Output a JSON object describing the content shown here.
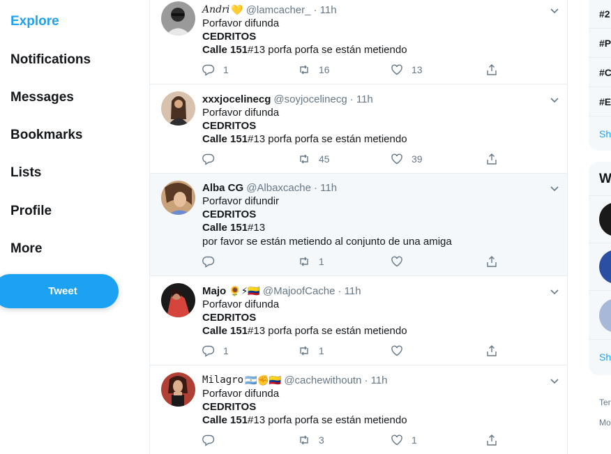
{
  "nav": {
    "items": [
      {
        "label": "Explore",
        "active": true
      },
      {
        "label": "Notifications"
      },
      {
        "label": "Messages"
      },
      {
        "label": "Bookmarks"
      },
      {
        "label": "Lists"
      },
      {
        "label": "Profile"
      },
      {
        "label": "More"
      }
    ],
    "tweet_button": "Tweet"
  },
  "tweets": [
    {
      "name": "Andri",
      "name_emoji": "💛",
      "handle": "@lamcacher_",
      "time": "· 11h",
      "line1": "Porfavor difunda",
      "line2": "CEDRITOS",
      "line3_bold": "Calle 151",
      "line3_rest": "#13 porfa porfa se están metiendo",
      "replies": "1",
      "retweets": "16",
      "likes": "13"
    },
    {
      "name": "xxxjocelinecg",
      "handle": "@soyjocelinecg",
      "time": "· 11h",
      "line1": "Porfavor difunda",
      "line2": "CEDRITOS",
      "line3_bold": "Calle 151",
      "line3_rest": "#13 porfa porfa se están metiendo",
      "replies": "",
      "retweets": "45",
      "likes": "39"
    },
    {
      "name": "Alba CG",
      "handle": "@Albaxcache",
      "time": "· 11h",
      "line1": "Porfavor difundir",
      "line2": "CEDRITOS",
      "line3_bold": "Calle 151",
      "line3_rest": "#13",
      "line4": "por favor se están metiendo al conjunto de una amiga",
      "replies": "",
      "retweets": "1",
      "likes": ""
    },
    {
      "name": "Majo",
      "name_emoji": "🌻⚡🇨🇴",
      "handle": "@MajoofCache",
      "time": "· 11h",
      "line1": "Porfavor difunda",
      "line2": "CEDRITOS",
      "line3_bold": "Calle 151",
      "line3_rest": "#13 porfa porfa se están metiendo",
      "replies": "1",
      "retweets": "1",
      "likes": ""
    },
    {
      "name": "Milagro",
      "name_emoji": "🇦🇷✊🇨🇴",
      "handle": "@cachewithoutn",
      "time": "· 11h",
      "line1": "Porfavor difunda",
      "line2": "CEDRITOS",
      "line3_bold": "Calle 151",
      "line3_rest": "#13 porfa porfa se están metiendo",
      "replies": "",
      "retweets": "3",
      "likes": "1"
    }
  ],
  "right": {
    "trends": [
      "#2",
      "#P",
      "#C",
      "#E"
    ],
    "show_more_1": "Sh",
    "who_title": "W",
    "show_more_2": "Sh",
    "footer_1": "Ter",
    "footer_2": "Mo"
  },
  "colors": {
    "accent": "#1da1f2",
    "text": "#14171a",
    "muted": "#657786",
    "border": "#e6ecf0",
    "highlight_bg": "#f5f8fa"
  }
}
